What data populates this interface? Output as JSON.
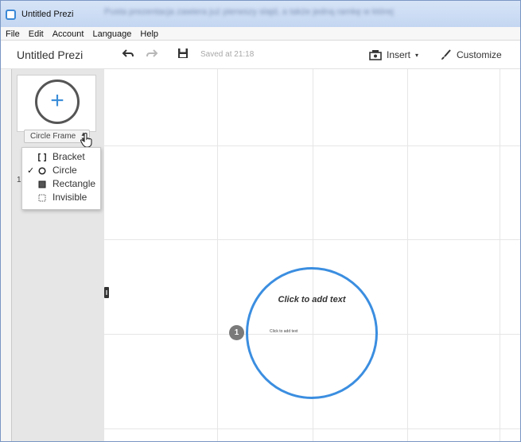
{
  "window": {
    "title": "Untitled Prezi",
    "blurred_caption": "Pusta prezentacja zawiera już pierwszy slajd, a także jedną ramkę w której"
  },
  "menu": {
    "items": [
      "File",
      "Edit",
      "Account",
      "Language",
      "Help"
    ]
  },
  "toolbar": {
    "doc_title": "Untitled Prezi",
    "saved_status": "Saved at 21:18",
    "insert_label": "Insert",
    "customize_label": "Customize"
  },
  "sidebar": {
    "slide_number": "1",
    "frame_type_label": "Circle Frame"
  },
  "frame_menu": {
    "options": [
      {
        "label": "Bracket",
        "checked": false
      },
      {
        "label": "Circle",
        "checked": true
      },
      {
        "label": "Rectangle",
        "checked": false
      },
      {
        "label": "Invisible",
        "checked": false
      }
    ],
    "check_glyph": "✓"
  },
  "canvas": {
    "frame_title": "Click to add text",
    "frame_body": "Click to add text",
    "path_number": "1"
  },
  "colors": {
    "accent": "#3b8ee0",
    "plus": "#3b8dd8",
    "badge": "#7a7a7a"
  }
}
